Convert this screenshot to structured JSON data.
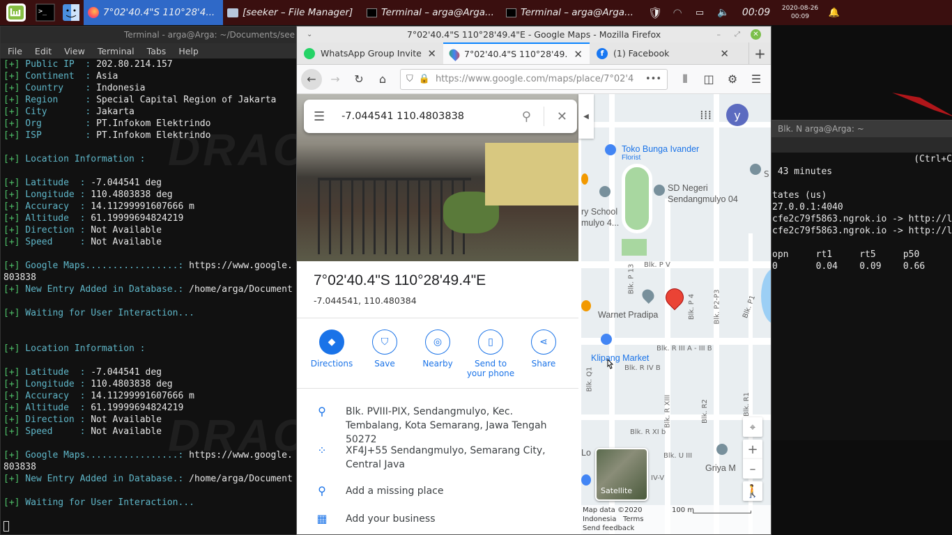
{
  "panel": {
    "tasks": [
      {
        "label": "7°02'40.4\"S 110°28'4...",
        "active": true
      },
      {
        "label": "[seeker – File Manager]",
        "active": false
      },
      {
        "label": "Terminal – arga@Arga...",
        "active": false
      },
      {
        "label": "Terminal – arga@Arga...",
        "active": false
      }
    ],
    "clock": "00:09",
    "date": "2020-08-26",
    "time_small": "00:09"
  },
  "terminal_left": {
    "title": "Terminal - arga@Arga: ~/Documents/see",
    "menu": [
      "File",
      "Edit",
      "View",
      "Terminal",
      "Tabs",
      "Help"
    ],
    "lines": [
      {
        "p": "[+]",
        "k": " Public IP  : ",
        "v": "202.80.214.157"
      },
      {
        "p": "[+]",
        "k": " Continent  : ",
        "v": "Asia"
      },
      {
        "p": "[+]",
        "k": " Country    : ",
        "v": "Indonesia"
      },
      {
        "p": "[+]",
        "k": " Region     : ",
        "v": "Special Capital Region of Jakarta"
      },
      {
        "p": "[+]",
        "k": " City       : ",
        "v": "Jakarta"
      },
      {
        "p": "[+]",
        "k": " Org        : ",
        "v": "PT.Infokom Elektrindo"
      },
      {
        "p": "[+]",
        "k": " ISP        : ",
        "v": "PT.Infokom Elektrindo"
      },
      {
        "p": "",
        "k": "",
        "v": ""
      },
      {
        "p": "[+]",
        "k": " Location Information :",
        "v": ""
      },
      {
        "p": "",
        "k": "",
        "v": ""
      },
      {
        "p": "[+]",
        "k": " Latitude  : ",
        "v": "-7.044541 deg"
      },
      {
        "p": "[+]",
        "k": " Longitude : ",
        "v": "110.4803838 deg"
      },
      {
        "p": "[+]",
        "k": " Accuracy  : ",
        "v": "14.11299991607666 m"
      },
      {
        "p": "[+]",
        "k": " Altitude  : ",
        "v": "61.19999694824219"
      },
      {
        "p": "[+]",
        "k": " Direction : ",
        "v": "Not Available"
      },
      {
        "p": "[+]",
        "k": " Speed     : ",
        "v": "Not Available"
      },
      {
        "p": "",
        "k": "",
        "v": ""
      },
      {
        "p": "[+]",
        "k": " Google Maps.................: ",
        "v": "https://www.google."
      },
      {
        "p": "",
        "k": "",
        "v": "803838"
      },
      {
        "p": "[+]",
        "k": " New Entry Added in Database.: ",
        "v": "/home/arga/Document"
      },
      {
        "p": "",
        "k": "",
        "v": ""
      },
      {
        "p": "[+]",
        "k": " Waiting for User Interaction...",
        "v": ""
      },
      {
        "p": "",
        "k": "",
        "v": ""
      },
      {
        "p": "",
        "k": "",
        "v": ""
      },
      {
        "p": "[+]",
        "k": " Location Information :",
        "v": ""
      },
      {
        "p": "",
        "k": "",
        "v": ""
      },
      {
        "p": "[+]",
        "k": " Latitude  : ",
        "v": "-7.044541 deg"
      },
      {
        "p": "[+]",
        "k": " Longitude : ",
        "v": "110.4803838 deg"
      },
      {
        "p": "[+]",
        "k": " Accuracy  : ",
        "v": "14.11299991607666 m"
      },
      {
        "p": "[+]",
        "k": " Altitude  : ",
        "v": "61.19999694824219"
      },
      {
        "p": "[+]",
        "k": " Direction : ",
        "v": "Not Available"
      },
      {
        "p": "[+]",
        "k": " Speed     : ",
        "v": "Not Available"
      },
      {
        "p": "",
        "k": "",
        "v": ""
      },
      {
        "p": "[+]",
        "k": " Google Maps.................: ",
        "v": "https://www.google."
      },
      {
        "p": "",
        "k": "",
        "v": "803838"
      },
      {
        "p": "[+]",
        "k": " New Entry Added in Database.: ",
        "v": "/home/arga/Document"
      },
      {
        "p": "",
        "k": "",
        "v": ""
      },
      {
        "p": "[+]",
        "k": " Waiting for User Interaction...",
        "v": ""
      }
    ]
  },
  "terminal_right": {
    "title": "Blk. N arga@Arga: ~",
    "hint": "(Ctrl+C",
    "lines": [
      "",
      " 43 minutes",
      "",
      "tates (us)",
      "27.0.0.1:4040",
      "cfe2c79f5863.ngrok.io -> http://lo",
      "cfe2c79f5863.ngrok.io -> http://l",
      "",
      "opn     rt1     rt5     p50",
      "0       0.04    0.09    0.66"
    ]
  },
  "firefox": {
    "title": "7°02'40.4\"S 110°28'49.4\"E - Google Maps - Mozilla Firefox",
    "tabs": [
      {
        "label": "WhatsApp Group Invite",
        "icon": "whatsapp-icon"
      },
      {
        "label": "7°02'40.4\"S 110°28'49.4\"E",
        "icon": "google-maps-icon"
      },
      {
        "label": "(1) Facebook",
        "icon": "facebook-icon"
      }
    ],
    "url": "https://www.google.com/maps/place/7°02'4"
  },
  "maps": {
    "search_value": "-7.044541 110.4803838",
    "place_title": "7°02'40.4\"S 110°28'49.4\"E",
    "place_coords": "-7.044541, 110.480384",
    "actions": [
      "Directions",
      "Save",
      "Nearby",
      "Send to your phone",
      "Share"
    ],
    "address": "Blk. PVIII-PIX, Sendangmulyo, Kec. Tembalang, Kota Semarang, Jawa Tengah 50272",
    "plus_code": "XF4J+55 Sendangmulyo, Semarang City, Central Java",
    "add_missing": "Add a missing place",
    "add_business": "Add your business",
    "avatar_letter": "y",
    "map_labels": {
      "toko": "Toko Bunga Ivander",
      "florist": "Florist",
      "sd": "SD Negeri",
      "sd2": "Sendangmulyo 04",
      "school": "ry School",
      "school2": "mulyo 4...",
      "warnet": "Warnet Pradipa",
      "market": "Klipang Market",
      "griya": "Griya M",
      "lo": "Lo",
      "satellite": "Satellite",
      "map_data": "Map data ©2020",
      "indonesia": "Indonesia",
      "terms": "Terms",
      "scale": "100 m",
      "feedback": "Send feedback",
      "blk_pv": "Blk. P V",
      "blk_p13": "Blk. P 13",
      "blk_p4": "Blk. P 4",
      "blk_p2p3": "Blk. P2-P3",
      "blk_p1": "Blk. P1",
      "blk_r3": "Blk. R III A - III B",
      "blk_r4": "Blk. R IV B",
      "blk_q1": "Blk. Q1",
      "blk_r13": "Blk. R XIII",
      "blk_r2": "Blk. R2",
      "blk_r1": "Blk. R1",
      "blk_r11": "Blk. R XI b",
      "blk_u3": "Blk. U III",
      "blk_iv": "IV-V",
      "blk_s": "S"
    }
  },
  "colors": {
    "panel": "#3a0f0f",
    "accent": "#1a73e8",
    "term_green": "#4fc36a",
    "term_cyan": "#5fb7c9",
    "pin": "#ea4335"
  }
}
